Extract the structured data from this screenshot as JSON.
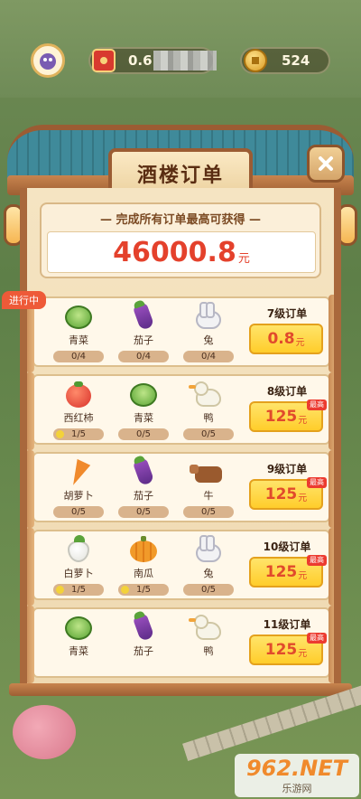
{
  "header": {
    "money_value": "0.6",
    "coin_value": "524"
  },
  "title": "酒楼订单",
  "reward": {
    "caption": "— 完成所有订单最高可获得 —",
    "value": "46000.8",
    "unit": "元"
  },
  "in_progress_label": "进行中",
  "orders": [
    {
      "level": "7级订单",
      "amount": "0.8",
      "unit": "元",
      "badge": "",
      "items": [
        {
          "name": "青菜",
          "progress": "0/4",
          "icon": "cabbage-icon"
        },
        {
          "name": "茄子",
          "progress": "0/4",
          "icon": "eggplant-icon"
        },
        {
          "name": "兔",
          "progress": "0/4",
          "icon": "rabbit-icon"
        }
      ]
    },
    {
      "level": "8级订单",
      "amount": "125",
      "unit": "元",
      "badge": "最高",
      "items": [
        {
          "name": "西红柿",
          "progress": "1/5",
          "icon": "tomato-icon"
        },
        {
          "name": "青菜",
          "progress": "0/5",
          "icon": "cabbage-icon"
        },
        {
          "name": "鸭",
          "progress": "0/5",
          "icon": "duck-icon"
        }
      ]
    },
    {
      "level": "9级订单",
      "amount": "125",
      "unit": "元",
      "badge": "最高",
      "items": [
        {
          "name": "胡萝卜",
          "progress": "0/5",
          "icon": "carrot-icon"
        },
        {
          "name": "茄子",
          "progress": "0/5",
          "icon": "eggplant-icon"
        },
        {
          "name": "牛",
          "progress": "0/5",
          "icon": "cow-icon"
        }
      ]
    },
    {
      "level": "10级订单",
      "amount": "125",
      "unit": "元",
      "badge": "最高",
      "items": [
        {
          "name": "白萝卜",
          "progress": "1/5",
          "icon": "radish-icon"
        },
        {
          "name": "南瓜",
          "progress": "1/5",
          "icon": "pumpkin-icon"
        },
        {
          "name": "兔",
          "progress": "0/5",
          "icon": "rabbit-icon"
        }
      ]
    },
    {
      "level": "11级订单",
      "amount": "125",
      "unit": "元",
      "badge": "最高",
      "items": [
        {
          "name": "青菜",
          "progress": "",
          "icon": "cabbage-icon"
        },
        {
          "name": "茄子",
          "progress": "",
          "icon": "eggplant-icon"
        },
        {
          "name": "鸭",
          "progress": "",
          "icon": "duck-icon"
        }
      ]
    }
  ],
  "watermark": {
    "main": "962.NET",
    "sub": "乐游网"
  }
}
